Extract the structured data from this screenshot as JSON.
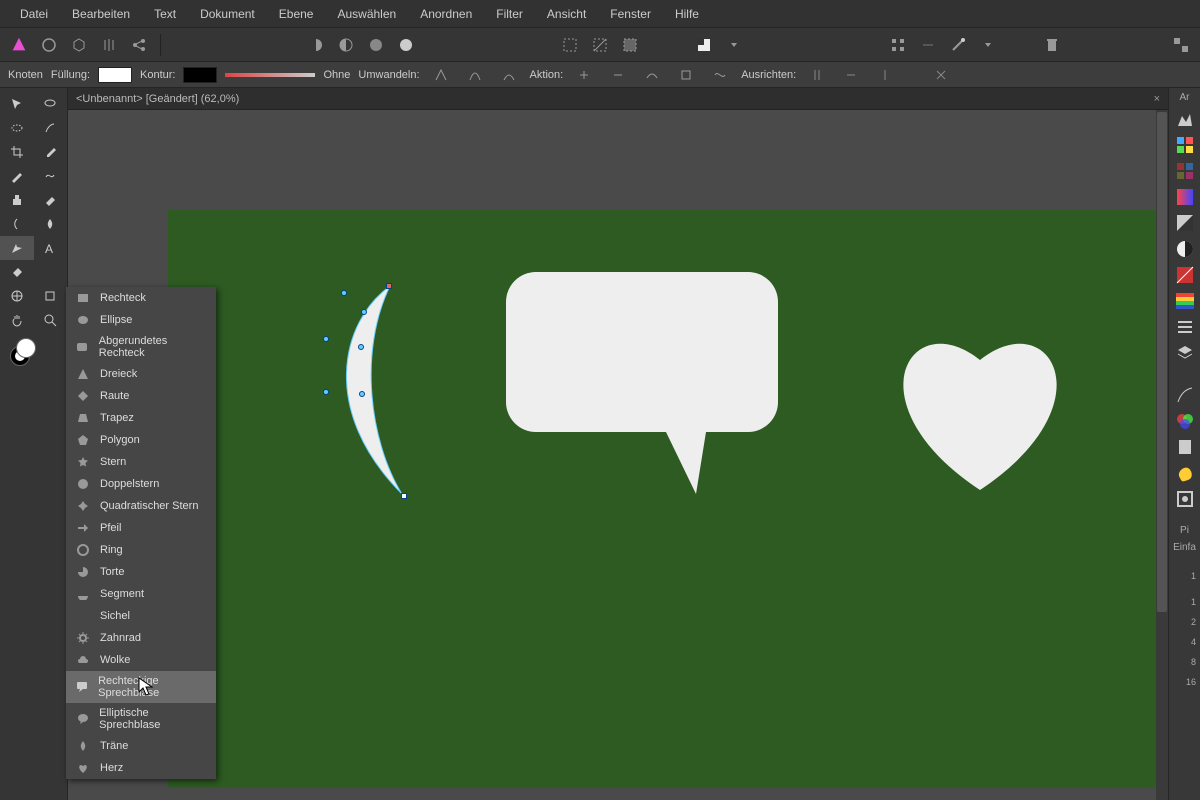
{
  "menubar": [
    "Datei",
    "Bearbeiten",
    "Text",
    "Dokument",
    "Ebene",
    "Auswählen",
    "Anordnen",
    "Filter",
    "Ansicht",
    "Fenster",
    "Hilfe"
  ],
  "tab_title": "<Unbenannt> [Geändert] (62,0%)",
  "optbar": {
    "knoten": "Knoten",
    "fill": "Füllung:",
    "stroke": "Kontur:",
    "none": "Ohne",
    "convert": "Umwandeln:",
    "action": "Aktion:",
    "align": "Ausrichten:"
  },
  "popup": {
    "items": [
      "Rechteck",
      "Ellipse",
      "Abgerundetes Rechteck",
      "Dreieck",
      "Raute",
      "Trapez",
      "Polygon",
      "Stern",
      "Doppelstern",
      "Quadratischer Stern",
      "Pfeil",
      "Ring",
      "Torte",
      "Segment",
      "Sichel",
      "Zahnrad",
      "Wolke",
      "Rechteckige Sprechblase",
      "Elliptische Sprechblase",
      "Träne",
      "Herz"
    ],
    "hover_index": 17
  },
  "rtab1": "Ar",
  "rtab2": "Pi",
  "rtab3": "Einfa",
  "ruler": [
    "1",
    "1",
    "2",
    "4",
    "8",
    "16"
  ]
}
